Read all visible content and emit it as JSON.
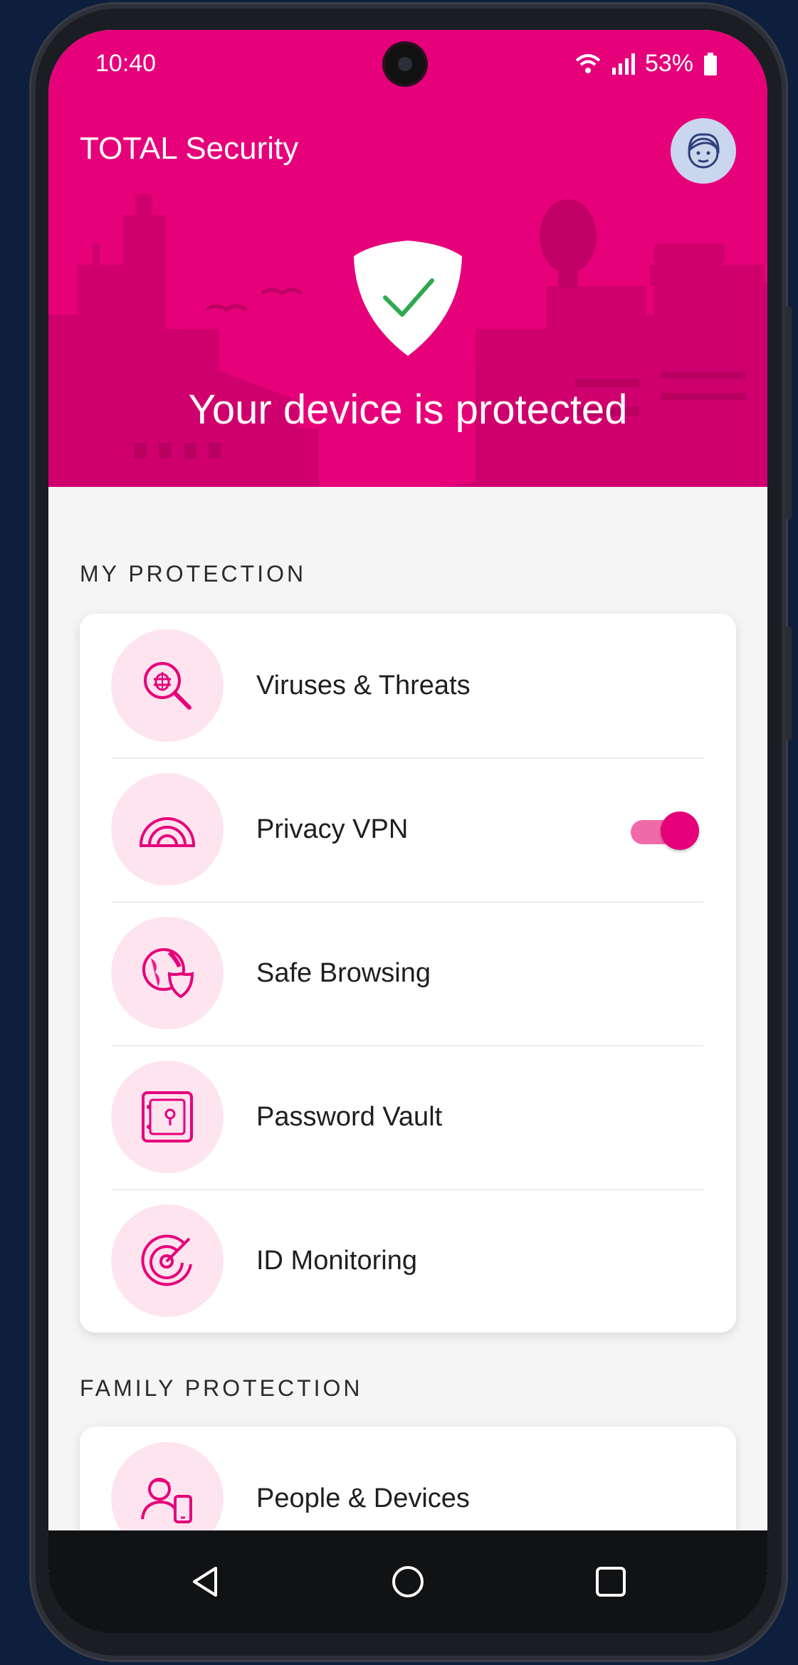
{
  "status_bar": {
    "time": "10:40",
    "battery": "53%"
  },
  "app": {
    "title": "TOTAL Security"
  },
  "hero": {
    "status_text": "Your device is protected"
  },
  "my_protection": {
    "label": "MY PROTECTION",
    "items": [
      {
        "label": "Viruses & Threats",
        "icon": "bug-search-icon"
      },
      {
        "label": "Privacy VPN",
        "icon": "vpn-signal-icon",
        "toggle": true
      },
      {
        "label": "Safe Browsing",
        "icon": "globe-shield-icon"
      },
      {
        "label": "Password Vault",
        "icon": "vault-icon"
      },
      {
        "label": "ID Monitoring",
        "icon": "target-icon"
      }
    ]
  },
  "family_protection": {
    "label": "FAMILY PROTECTION",
    "items": [
      {
        "label": "People & Devices",
        "icon": "person-device-icon"
      }
    ]
  },
  "colors": {
    "brand": "#e6007a",
    "brand_light": "#fde4ef",
    "background": "#0d1f3d"
  },
  "nav": {
    "back": "back-icon",
    "home": "home-icon",
    "recents": "recents-icon"
  }
}
